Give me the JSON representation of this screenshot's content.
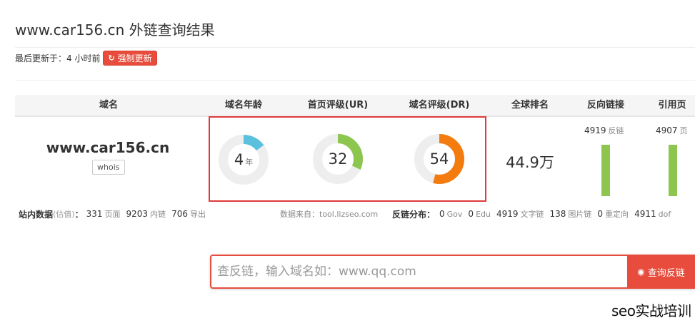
{
  "page": {
    "title": "www.car156.cn 外链查询结果",
    "last_updated_label": "最后更新于：4 小时前",
    "refresh_button": "强制更新"
  },
  "table": {
    "headers": [
      "域名",
      "域名年龄",
      "首页评级(UR)",
      "域名评级(DR)",
      "全球排名",
      "反向链接",
      "引用页"
    ],
    "domain": "www.car156.cn",
    "whois_button": "whois",
    "domain_age": {
      "value": "4",
      "unit": "年",
      "fraction": 0.15,
      "color": "#5bc0de"
    },
    "ur": {
      "value": "32",
      "fraction": 0.32,
      "color": "#8cc64f"
    },
    "dr": {
      "value": "54",
      "fraction": 0.54,
      "color": "#f47b0e"
    },
    "global_rank": "44.9万",
    "backlinks": {
      "value": "4919",
      "unit": "反链",
      "level": 1.0,
      "color": "#8cc64f"
    },
    "ref_pages": {
      "value": "4907",
      "unit": "页",
      "level": 1.0,
      "color": "#8cc64f"
    }
  },
  "site_stats": {
    "label": "站内数据",
    "label_note": "(估值)",
    "colon": "：",
    "pages": "331",
    "pages_unit": "页面",
    "internal_links": "9203",
    "internal_unit": "内链",
    "outbound": "706",
    "outbound_unit": "导出"
  },
  "source_text": "数据来自：tool.lizseo.com",
  "distribution": {
    "label": "反链分布：",
    "gov": "0",
    "gov_unit": "Gov",
    "edu": "0",
    "edu_unit": "Edu",
    "text_links": "4919",
    "text_unit": "文字链",
    "image_links": "138",
    "image_unit": "图片链",
    "redirects": "0",
    "redirect_unit": "重定向",
    "dofollow": "4911",
    "dofollow_unit": "dof"
  },
  "search": {
    "placeholder": "查反链，输入域名如：www.qq.com",
    "button": "查询反链"
  },
  "watermark": "seo实战培训"
}
